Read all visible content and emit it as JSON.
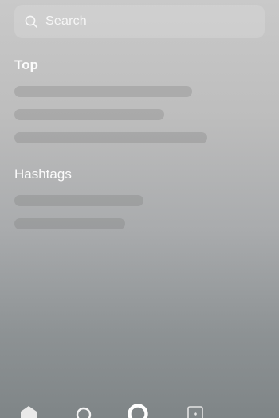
{
  "search": {
    "placeholder": "Search"
  },
  "sections": {
    "top_title": "Top",
    "hashtags_title": "Hashtags"
  },
  "icons": {
    "search": "search-icon",
    "home": "home-icon",
    "discover": "circle-icon",
    "search_tab": "ring-icon",
    "inbox": "square-dot-icon"
  },
  "colors": {
    "text": "#fbfbfb",
    "search_bg": "rgba(255,255,255,0.14)",
    "placeholder": "rgba(120,120,120,0.28)"
  }
}
